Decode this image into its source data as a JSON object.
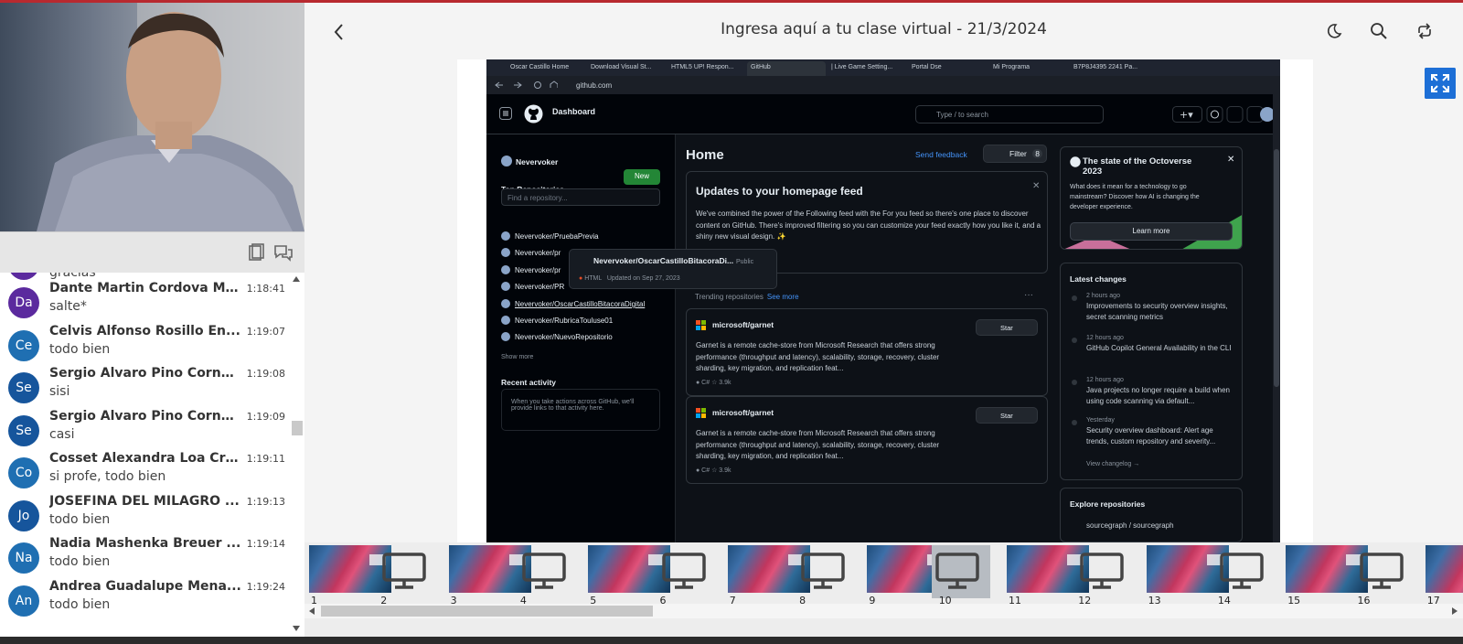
{
  "header": {
    "title": "Ingresa aquí a tu clase virtual - 21/3/2024"
  },
  "chat": {
    "partial_top": "gracias",
    "messages": [
      {
        "initials": "Da",
        "color": "#5b2a9e",
        "name": "Dante Martin Cordova Ma...",
        "time": "1:18:41",
        "text": "salte*"
      },
      {
        "initials": "Ce",
        "color": "#1f6fb2",
        "name": "Celvis Alfonso Rosillo En...",
        "time": "1:19:07",
        "text": "todo bien"
      },
      {
        "initials": "Se",
        "color": "#16559c",
        "name": "Sergio Alvaro Pino Cornejo",
        "time": "1:19:08",
        "text": "sisi"
      },
      {
        "initials": "Se",
        "color": "#16559c",
        "name": "Sergio Alvaro Pino Cornejo",
        "time": "1:19:09",
        "text": "casi"
      },
      {
        "initials": "Co",
        "color": "#1f6fb2",
        "name": "Cosset Alexandra Loa Cruz",
        "time": "1:19:11",
        "text": "si profe, todo bien"
      },
      {
        "initials": "Jo",
        "color": "#16559c",
        "name": "JOSEFINA DEL MILAGRO ...",
        "time": "1:19:13",
        "text": "todo bien"
      },
      {
        "initials": "Na",
        "color": "#1f6fb2",
        "name": "Nadia Mashenka Breuer ...",
        "time": "1:19:14",
        "text": "todo bien"
      },
      {
        "initials": "An",
        "color": "#1f6fb2",
        "name": "Andrea Guadalupe Mena...",
        "time": "1:19:24",
        "text": "todo bien"
      }
    ]
  },
  "browser": {
    "tabs": [
      "Oscar Castillo Home",
      "Download Visual St...",
      "HTML5 UP! Respon...",
      "GitHub",
      "| Live Game Setting...",
      "Portal Dse",
      "Mi Programa",
      "B7P8J4395 2241 Pa..."
    ],
    "url": "github.com"
  },
  "github": {
    "dashboard": "Dashboard",
    "search": "Type / to search",
    "user": "Nevervoker",
    "top_repos": "Top Repositories",
    "new": "New",
    "find": "Find a repository...",
    "repos": [
      "Nevervoker/PruebaPrevia",
      "Nevervoker/pr",
      "Nevervoker/pr",
      "Nevervoker/PR",
      "Nevervoker/OscarCastilloBitacoraDigital",
      "Nevervoker/RubricaTouluse01",
      "Nevervoker/NuevoRepositorio"
    ],
    "show_more": "Show more",
    "recent_activity": "Recent activity",
    "recent_text": "When you take actions across GitHub, we'll provide links to that activity here.",
    "hover": {
      "title": "Nevervoker/OscarCastilloBitacoraDi...",
      "badge": "Public",
      "lang": "HTML",
      "updated": "Updated on Sep 27, 2023"
    },
    "home": "Home",
    "send_feedback": "Send feedback",
    "filter": "Filter",
    "filter_count": "8",
    "updates_title": "Updates to your homepage feed",
    "updates_text": "We've combined the power of the Following feed with the For you feed so there's one place to discover content on GitHub. There's improved filtering so you can customize your feed exactly how you like it, and a shiny new visual design. ✨",
    "trending": "Trending repositories",
    "see_more": "See more",
    "cards": [
      {
        "name": "microsoft/garnet",
        "desc": "Garnet is a remote cache-store from Microsoft Research that offers strong performance (throughput and latency), scalability, storage, recovery, cluster sharding, key migration, and replication feat...",
        "meta": "● C#   ☆ 3.9k",
        "star": "Star"
      },
      {
        "name": "microsoft/garnet",
        "desc": "Garnet is a remote cache-store from Microsoft Research that offers strong performance (throughput and latency), scalability, storage, recovery, cluster sharding, key migration, and replication feat...",
        "meta": "● C#   ☆ 3.9k",
        "star": "Star"
      }
    ],
    "octoverse_title": "The state of the Octoverse 2023",
    "octoverse_text": "What does it mean for a technology to go mainstream? Discover how AI is changing the developer experience.",
    "learn_more": "Learn more",
    "latest": "Latest changes",
    "changes": [
      {
        "ago": "2 hours ago",
        "text": "Improvements to security overview insights, secret scanning metrics"
      },
      {
        "ago": "12 hours ago",
        "text": "GitHub Copilot General Availability in the CLI"
      },
      {
        "ago": "12 hours ago",
        "text": "Java projects no longer require a build when using code scanning via default..."
      },
      {
        "ago": "Yesterday",
        "text": "Security overview dashboard: Alert age trends, custom repository and severity..."
      }
    ],
    "view_changelog": "View changelog →",
    "explore": "Explore repositories",
    "explore_repo": "sourcegraph / sourcegraph"
  },
  "thumbnails": {
    "numbers": [
      "1",
      "2",
      "3",
      "4",
      "5",
      "6",
      "7",
      "8",
      "9",
      "10",
      "11",
      "12",
      "13",
      "14",
      "15",
      "16",
      "17"
    ],
    "selected": "10"
  }
}
